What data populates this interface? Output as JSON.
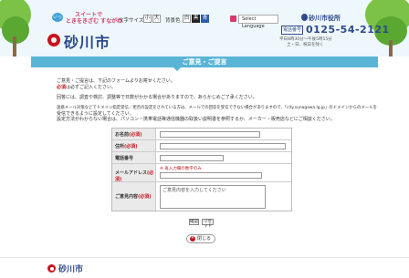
{
  "header": {
    "catch_badge": "いっ",
    "catch_line1": "スイートで",
    "catch_line2": "ときをきざむ すながわ",
    "logo_text": "砂川市",
    "text_size_label": "文字サイズ",
    "text_size_small": "小",
    "text_size_large": "大",
    "bg_color_label": "背景色",
    "bg_white": "白",
    "bg_black": "黒",
    "bg_blue": "青",
    "language_select": "Select Language",
    "office_name": "砂川市役所",
    "rep_badge": "電話番号",
    "phone": "0125-54-2121",
    "hours_line1": "平日8時30分〜午後5時15分",
    "hours_line2": "土・日、祝日を除く"
  },
  "title": "ご意見・ご提言",
  "intro": {
    "line1": "ご意見・ご提言は、下記のフォームよりお寄せください。",
    "line2_req": "必須",
    "line2_rest": "は必ずご記入ください。",
    "line3": "回答には、調査や検討、調整等で日数がかかる場合がありますので、あらかじめご了承ください。",
    "line4": "迷惑メール対策などでドメイン指定受信／拒否の設定をされている方は、メールでの回答を受信できない場合がありますので、「city.sunagawa.lg.jp」のドメインからのメールを",
    "line5": "受信できるように設定してください。",
    "line6": "設定方法がわからない場合は、パソコン・携帯電話等通信機器の取扱い説明書を参照するか、メーカー・販売店などにご相談ください。"
  },
  "form": {
    "required_mark": "(必須)",
    "name_label": "お名前",
    "address_label": "住所",
    "phone_label": "電話番号",
    "email_label": "メールアドレス",
    "email_note": "※ 再入力欄の数字のみ",
    "opinion_label": "ご意見内容",
    "opinion_placeholder": "ご意見内容を入力してください"
  },
  "buttons": {
    "confirm": "確認",
    "reset": "リセット",
    "close": "閉じる"
  },
  "footer": {
    "logo_text": "砂川市"
  }
}
